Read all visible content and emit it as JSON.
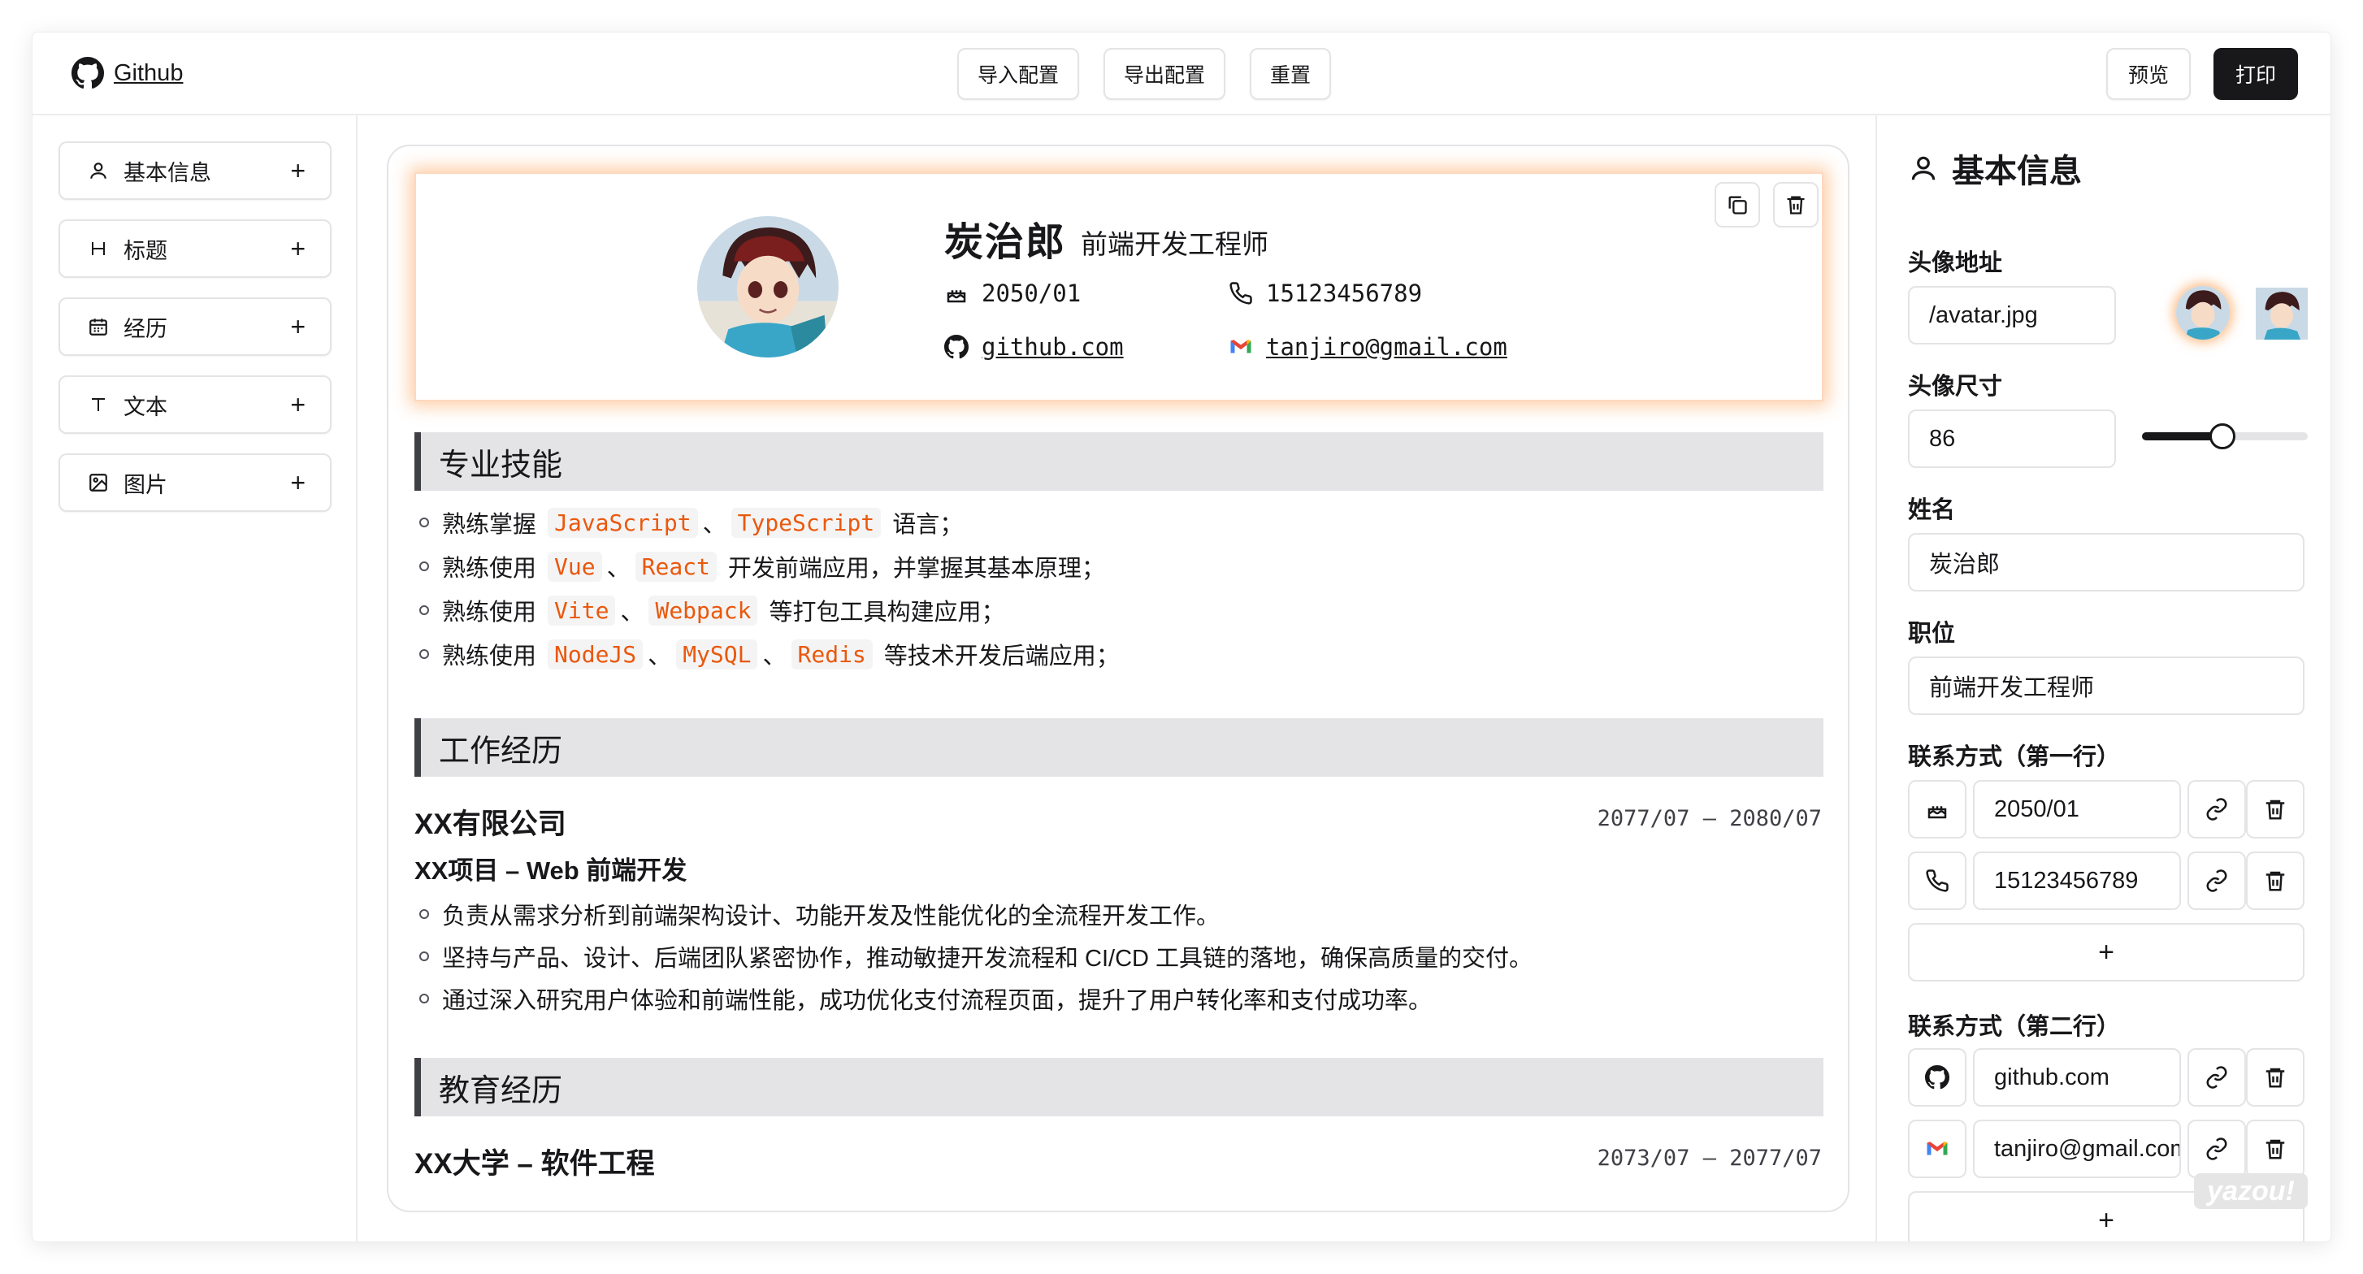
{
  "header": {
    "github_label": "Github",
    "import_label": "导入配置",
    "export_label": "导出配置",
    "reset_label": "重置",
    "preview_label": "预览",
    "print_label": "打印"
  },
  "sidebar": {
    "items": [
      {
        "label": "基本信息",
        "icon": "user-icon"
      },
      {
        "label": "标题",
        "icon": "heading-icon"
      },
      {
        "label": "经历",
        "icon": "calendar-icon"
      },
      {
        "label": "文本",
        "icon": "text-icon"
      },
      {
        "label": "图片",
        "icon": "image-icon"
      }
    ],
    "add_symbol": "+"
  },
  "resume": {
    "name": "炭治郎",
    "job_title": "前端开发工程师",
    "birth": "2050/01",
    "phone": "15123456789",
    "github": "github.com",
    "email": "tanjiro@gmail.com",
    "skills_title": "专业技能",
    "skills": [
      {
        "pre": "熟练掌握",
        "items": [
          "JavaScript",
          "TypeScript"
        ],
        "post": "语言；"
      },
      {
        "pre": "熟练使用",
        "items": [
          "Vue",
          "React"
        ],
        "post": "开发前端应用，并掌握其基本原理；"
      },
      {
        "pre": "熟练使用",
        "items": [
          "Vite",
          "Webpack"
        ],
        "post": "等打包工具构建应用；"
      },
      {
        "pre": "熟练使用",
        "items": [
          "NodeJS",
          "MySQL",
          "Redis"
        ],
        "post": "等技术开发后端应用；"
      }
    ],
    "separator": "、",
    "work_title": "工作经历",
    "company": "XX有限公司",
    "work_date": "2077/07 – 2080/07",
    "project": "XX项目 – Web 前端开发",
    "work_points": [
      "负责从需求分析到前端架构设计、功能开发及性能优化的全流程开发工作。",
      "坚持与产品、设计、后端团队紧密协作，推动敏捷开发流程和 CI/CD 工具链的落地，确保高质量的交付。",
      "通过深入研究用户体验和前端性能，成功优化支付流程页面，提升了用户转化率和支付成功率。"
    ],
    "edu_title": "教育经历",
    "school": "XX大学 – 软件工程",
    "edu_date": "2073/07 – 2077/07"
  },
  "panel": {
    "title": "基本信息",
    "avatar_label": "头像地址",
    "avatar_value": "/avatar.jpg",
    "size_label": "头像尺寸",
    "size_value": "86",
    "size_slider_percent": 48,
    "name_label": "姓名",
    "name_value": "炭治郎",
    "job_label": "职位",
    "job_value": "前端开发工程师",
    "line1_label": "联系方式（第一行）",
    "line1": [
      {
        "icon": "cake-icon",
        "value": "2050/01"
      },
      {
        "icon": "phone-icon",
        "value": "15123456789"
      }
    ],
    "line2_label": "联系方式（第二行）",
    "line2": [
      {
        "icon": "github-icon",
        "value": "github.com"
      },
      {
        "icon": "gmail-icon",
        "value": "tanjiro@gmail.com"
      }
    ],
    "add_symbol": "+",
    "watermark": "yazou!"
  },
  "colors": {
    "accent_code": "#ea580c",
    "glow": "#fb923c",
    "dark_button": "#18181b"
  }
}
